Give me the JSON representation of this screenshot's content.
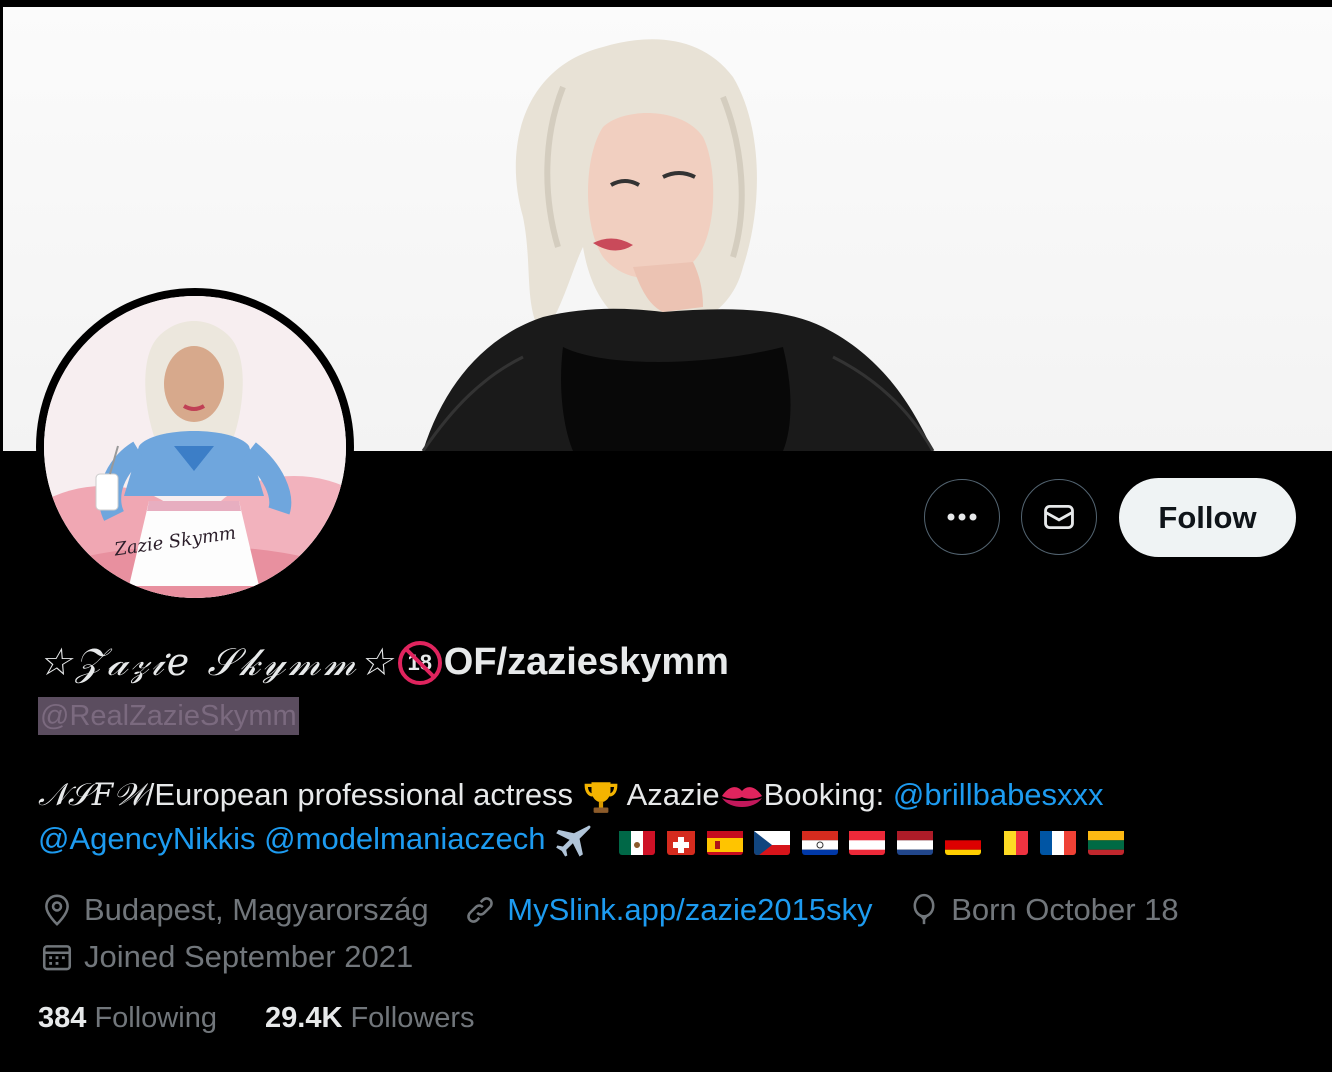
{
  "profile": {
    "display_name_script": "☆𝒵𝒶𝓏𝒾𝑒 𝒮𝓀𝓎𝓂𝓂☆",
    "display_name_badge": "18",
    "display_name_suffix": "OF/zazieskymm",
    "handle": "@RealZazieSkymm",
    "avatar_signature": "Zazie Skymm"
  },
  "actions": {
    "follow_label": "Follow",
    "more_icon": "more-icon",
    "message_icon": "envelope-icon"
  },
  "bio": {
    "nsfw": "𝒩𝒮𝐹𝒲",
    "text1": "/European professional actress ",
    "text2": " Azazie",
    "text3": "Booking: ",
    "mention1": "@brillbabesxxx",
    "mention2": "@AgencyNikkis",
    "mention3": "@modelmaniaczech",
    "emojis": [
      "trophy",
      "kiss-mark",
      "airplane"
    ],
    "flags": [
      "mexico",
      "switzerland",
      "spain",
      "czechia",
      "paraguay",
      "austria",
      "netherlands",
      "germany",
      "belgium",
      "france",
      "lithuania"
    ]
  },
  "meta": {
    "location": "Budapest, Magyarország",
    "website": "MySlink.app/zazie2015sky",
    "birthday": "Born October 18",
    "joined": "Joined September 2021"
  },
  "stats": {
    "following_count": "384",
    "following_label": "Following",
    "followers_count": "29.4K",
    "followers_label": "Followers"
  },
  "colors": {
    "background": "#000000",
    "text": "#e7e9ea",
    "muted": "#71767b",
    "link": "#1d9bf0",
    "follow_bg": "#eff3f4"
  }
}
